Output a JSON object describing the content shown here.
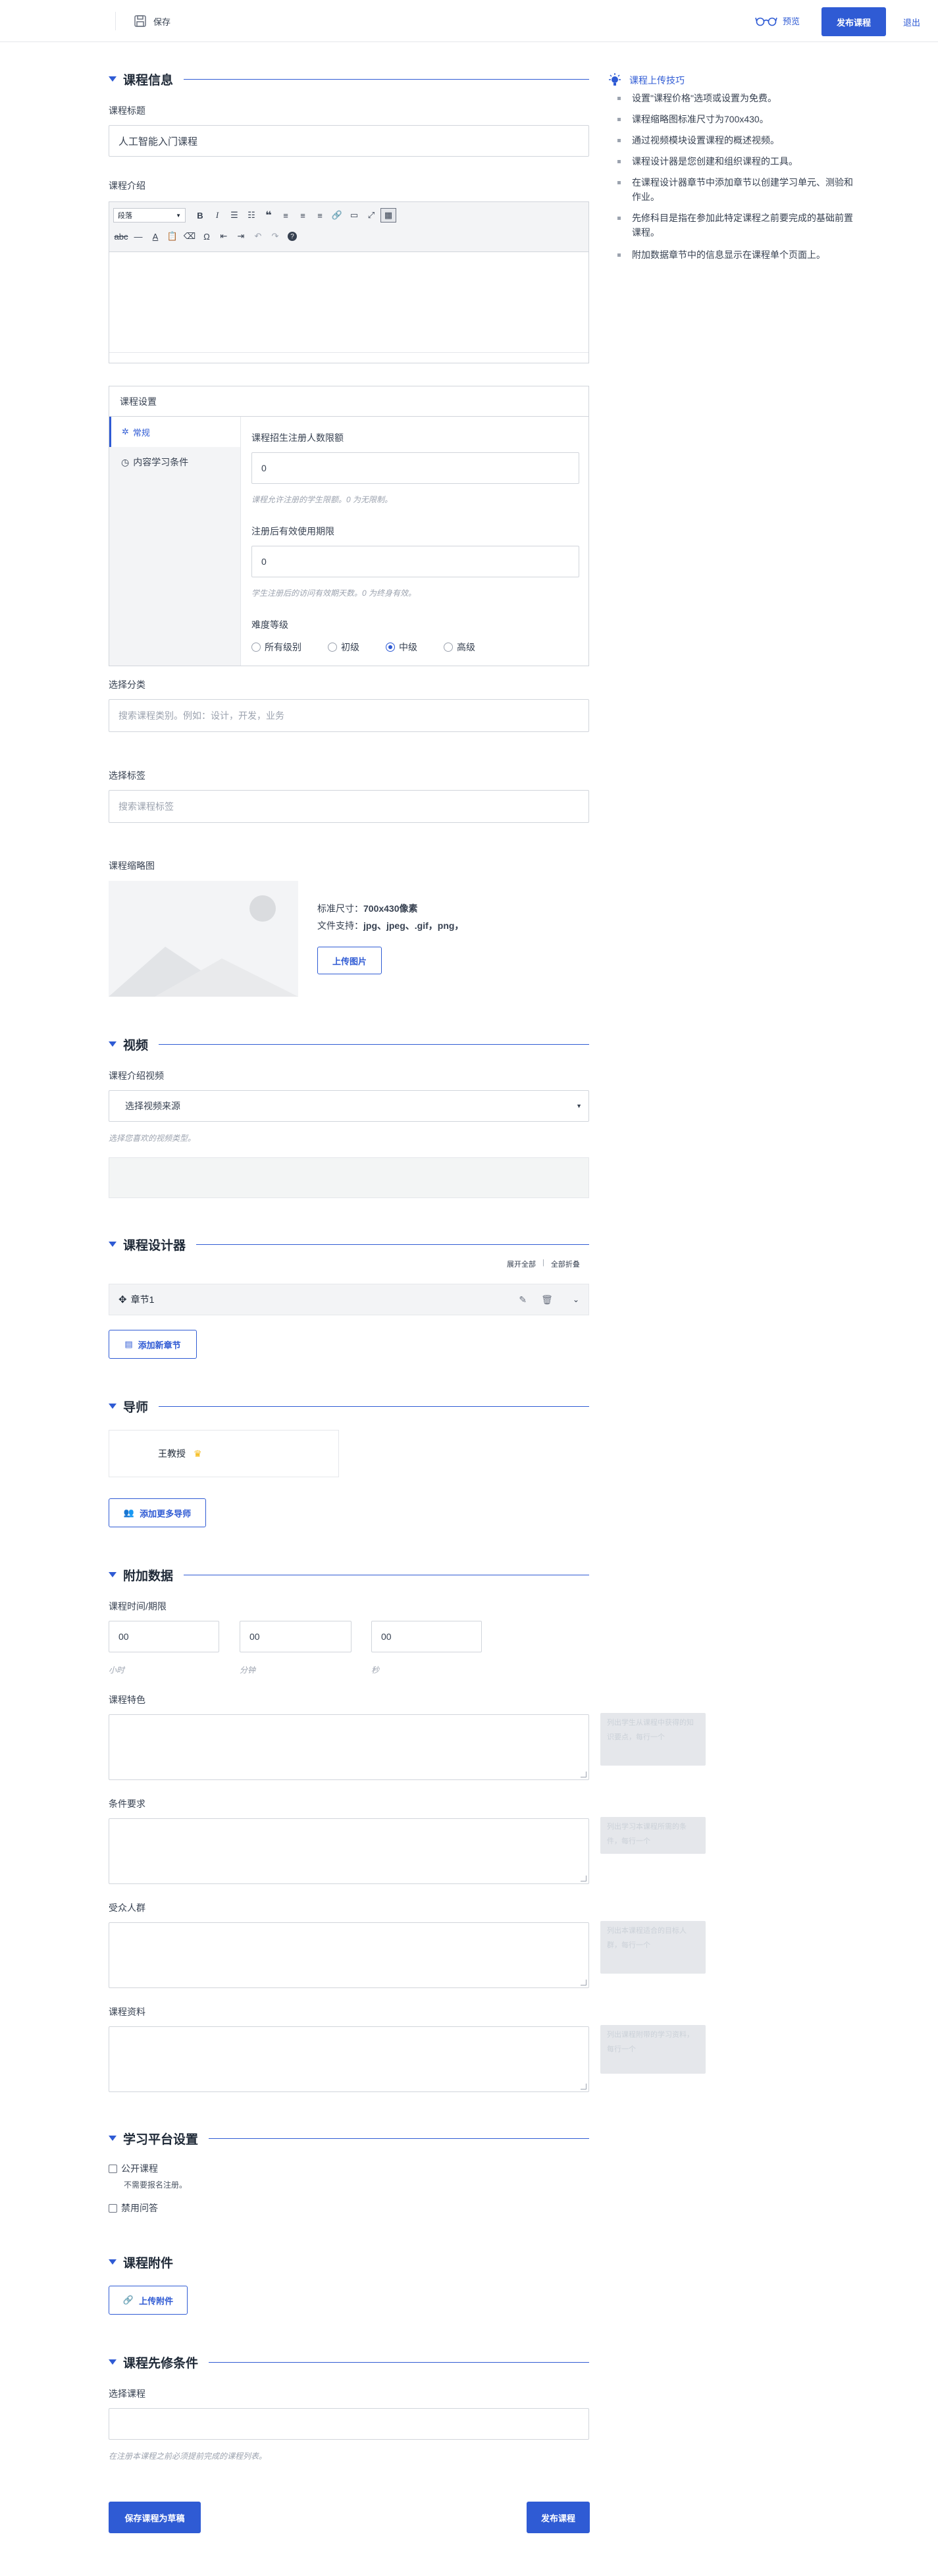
{
  "topbar": {
    "save": "保存",
    "preview": "预览",
    "publish": "发布课程",
    "exit": "退出"
  },
  "course_info": {
    "section": "课程信息",
    "title_label": "课程标题",
    "title_value": "人工智能入门课程",
    "intro_label": "课程介绍",
    "format_select": "段落"
  },
  "tips": {
    "heading": "课程上传技巧",
    "items": [
      "设置\"课程价格\"选项或设置为免费。",
      "课程缩略图标准尺寸为700x430。",
      "通过视频模块设置课程的概述视频。",
      "课程设计器是您创建和组织课程的工具。",
      "在课程设计器章节中添加章节以创建学习单元、测验和作业。",
      "先修科目是指在参加此特定课程之前要完成的基础前置课程。",
      "附加数据章节中的信息显示在课程单个页面上。"
    ]
  },
  "settings": {
    "heading": "课程设置",
    "tab_general": "常规",
    "tab_drip": "内容学习条件",
    "max_students_label": "课程招生注册人数限额",
    "max_students_value": "0",
    "max_students_hint": "课程允许注册的学生限额。0 为无限制。",
    "duration_label": "注册后有效使用期限",
    "duration_value": "0",
    "duration_hint": "学生注册后的访问有效期天数。0 为终身有效。",
    "level_label": "难度等级",
    "levels": [
      "所有级别",
      "初级",
      "中级",
      "高级"
    ],
    "level_selected": "中级"
  },
  "category": {
    "label": "选择分类",
    "placeholder": "搜索课程类别。例如：设计，开发，业务"
  },
  "tags": {
    "label": "选择标签",
    "placeholder": "搜索课程标签"
  },
  "thumb": {
    "label": "课程缩略图",
    "size_label": "标准尺寸：",
    "size_value": "700x430像素",
    "format_label": "文件支持：",
    "format_value": "jpg、jpeg、.gif，png，",
    "upload": "上传图片"
  },
  "video": {
    "section": "视频",
    "label": "课程介绍视频",
    "select": "选择视频来源",
    "hint": "选择您喜欢的视频类型。"
  },
  "builder": {
    "section": "课程设计器",
    "expand": "展开全部",
    "collapse": "全部折叠",
    "topic": "章节1",
    "add_topic": "添加新章节"
  },
  "instructor": {
    "section": "导师",
    "name": "王教授",
    "add": "添加更多导师"
  },
  "additional": {
    "section": "附加数据",
    "duration_label": "课程时间/期限",
    "h": "00",
    "m": "00",
    "s": "00",
    "h_label": "小时",
    "m_label": "分钟",
    "s_label": "秒",
    "benefits": "课程特色",
    "requirements": "条件要求",
    "audience": "受众人群",
    "materials": "课程资料",
    "benefits_tip": "列出学生从课程中获得的知识要点，每行一个",
    "requirements_tip": "列出学习本课程所需的条件，每行一个",
    "audience_tip": "列出本课程适合的目标人群，每行一个",
    "materials_tip": "列出课程附带的学习资料，每行一个"
  },
  "platform": {
    "section": "学习平台设置",
    "public": "公开课程",
    "public_hint": "不需要报名注册。",
    "disable_qa": "禁用问答"
  },
  "attachments": {
    "section": "课程附件",
    "upload": "上传附件"
  },
  "prereq": {
    "section": "课程先修条件",
    "label": "选择课程",
    "hint": "在注册本课程之前必须提前完成的课程列表。"
  },
  "footer": {
    "draft": "保存课程为草稿",
    "publish": "发布课程"
  }
}
